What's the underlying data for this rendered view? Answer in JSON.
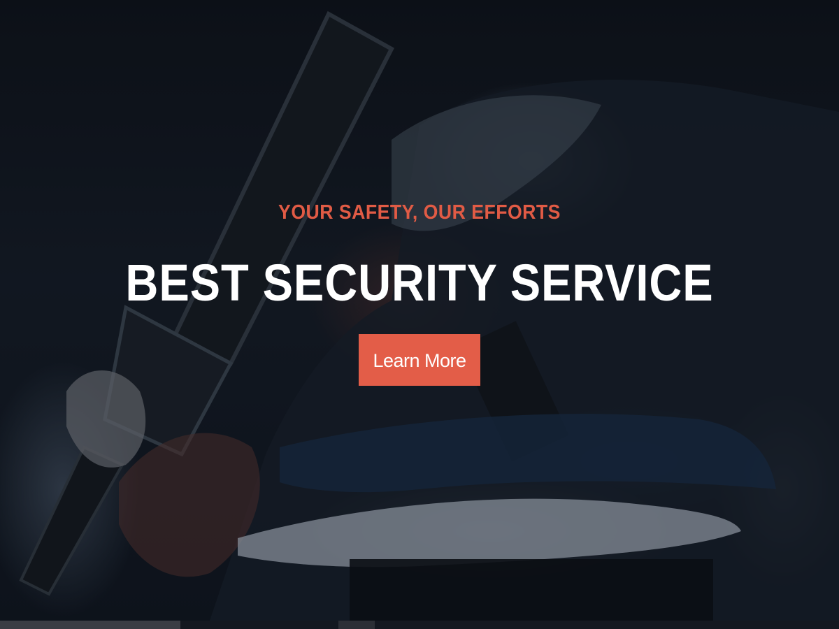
{
  "hero": {
    "tagline": "YOUR SAFETY, OUR EFFORTS",
    "headline": "BEST SECURITY SERVICE",
    "cta_label": "Learn More",
    "background_image": "armed-security-guard-photo"
  },
  "colors": {
    "accent": "#e35d48",
    "tagline": "#e15b45",
    "headline": "#ffffff",
    "background": "#10151d"
  }
}
